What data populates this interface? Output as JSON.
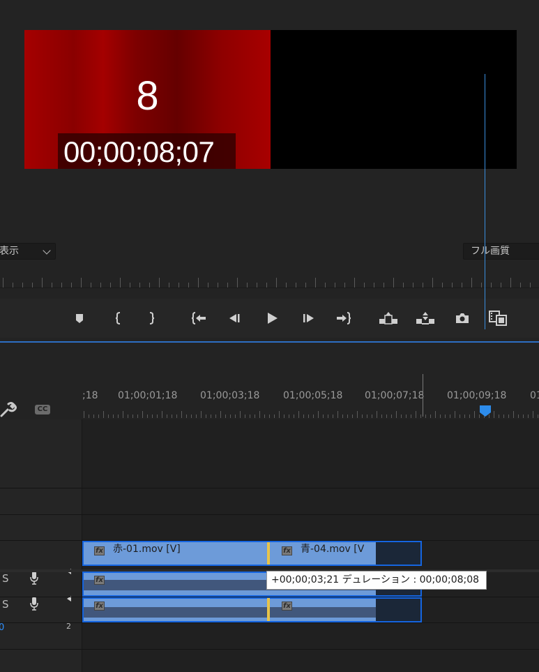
{
  "monitor": {
    "frame_number": "8",
    "overlay_timecode": "00;00;08;07",
    "view_dropdown_value": "表示",
    "resolution_dropdown_value": "フル画質"
  },
  "transport": {
    "buttons": [
      {
        "name": "add-marker-button",
        "icon": "marker-icon"
      },
      {
        "name": "mark-in-button",
        "icon": "mark-in-icon"
      },
      {
        "name": "mark-out-button",
        "icon": "mark-out-icon"
      },
      {
        "name": "go-to-in-button",
        "icon": "go-to-in-icon"
      },
      {
        "name": "step-back-button",
        "icon": "step-back-icon"
      },
      {
        "name": "play-button",
        "icon": "play-icon"
      },
      {
        "name": "step-forward-button",
        "icon": "step-forward-icon"
      },
      {
        "name": "go-to-out-button",
        "icon": "go-to-out-icon"
      },
      {
        "name": "lift-button",
        "icon": "lift-icon"
      },
      {
        "name": "extract-button",
        "icon": "extract-icon"
      },
      {
        "name": "export-frame-button",
        "icon": "camera-icon"
      },
      {
        "name": "comparison-view-button",
        "icon": "comparison-view-icon"
      }
    ]
  },
  "timeline": {
    "ruler_labels": [
      ";18",
      "01;00;01;18",
      "01;00;03;18",
      "01;00;05;18",
      "01;00;07;18",
      "01;00;09;18",
      "01"
    ],
    "tracks": {
      "a_track_1_letter": "S",
      "a_track_2_letter": "S",
      "mix_value": "0",
      "mix_channels": "2"
    },
    "clips": {
      "clip_1_name": "赤-01.mov [V]",
      "clip_2_name": "青-04.mov [V"
    },
    "tooltip": "+00;00;03;21 デュレーション : 00;00;08;08"
  },
  "colors": {
    "accent": "#2d8ceb",
    "clip_video": "#6d9bd9",
    "clip_border": "#1565e0",
    "edit_point": "#e8c44a",
    "red_clip": "#a50000"
  }
}
